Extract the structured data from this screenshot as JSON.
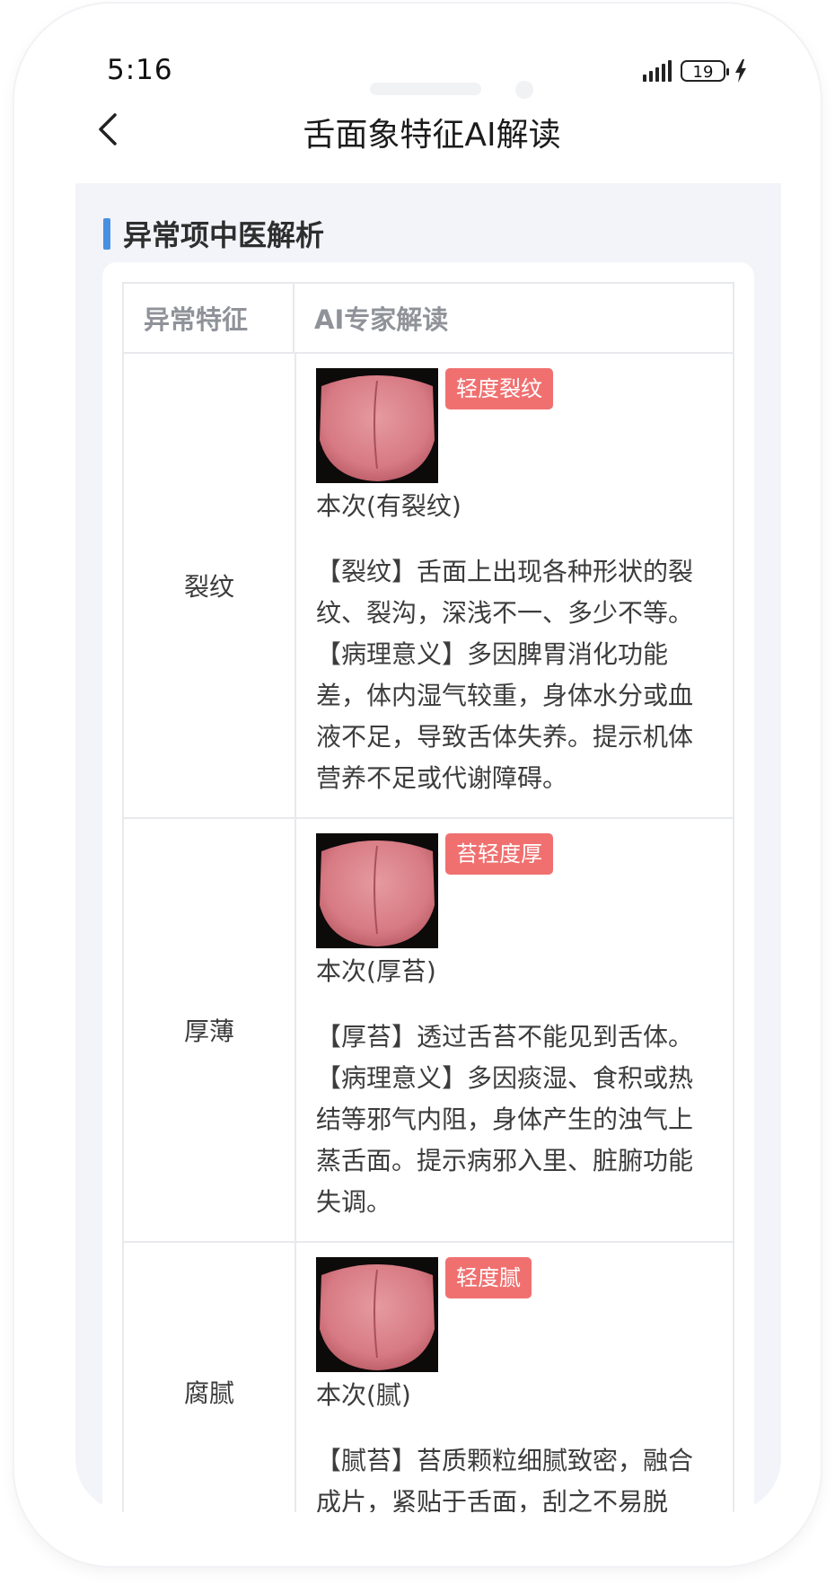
{
  "status_bar": {
    "time": "5:16",
    "battery": "19"
  },
  "nav": {
    "title": "舌面象特征AI解读"
  },
  "section": {
    "title": "异常项中医解析"
  },
  "table": {
    "header": {
      "feature": "异常特征",
      "interpretation": "AI专家解读"
    },
    "rows": [
      {
        "feature": "裂纹",
        "badge": "轻度裂纹",
        "caption": "本次(有裂纹)",
        "desc": "【裂纹】舌面上出现各种形状的裂纹、裂沟，深浅不一、多少不等。【病理意义】多因脾胃消化功能差，体内湿气较重，身体水分或血液不足，导致舌体失养。提示机体营养不足或代谢障碍。"
      },
      {
        "feature": "厚薄",
        "badge": "苔轻度厚",
        "caption": "本次(厚苔)",
        "desc": "【厚苔】透过舌苔不能见到舌体。【病理意义】多因痰湿、食积或热结等邪气内阻，身体产生的浊气上蒸舌面。提示病邪入里、脏腑功能失调。"
      },
      {
        "feature": "腐腻",
        "badge": "轻度腻",
        "caption": "本次(腻)",
        "desc": "【腻苔】苔质颗粒细腻致密，融合成片，紧贴于舌面，刮之不易脱"
      }
    ]
  },
  "colors": {
    "accent": "#4a90e2",
    "badge": "#f07070",
    "background": "#f2f4f9"
  }
}
